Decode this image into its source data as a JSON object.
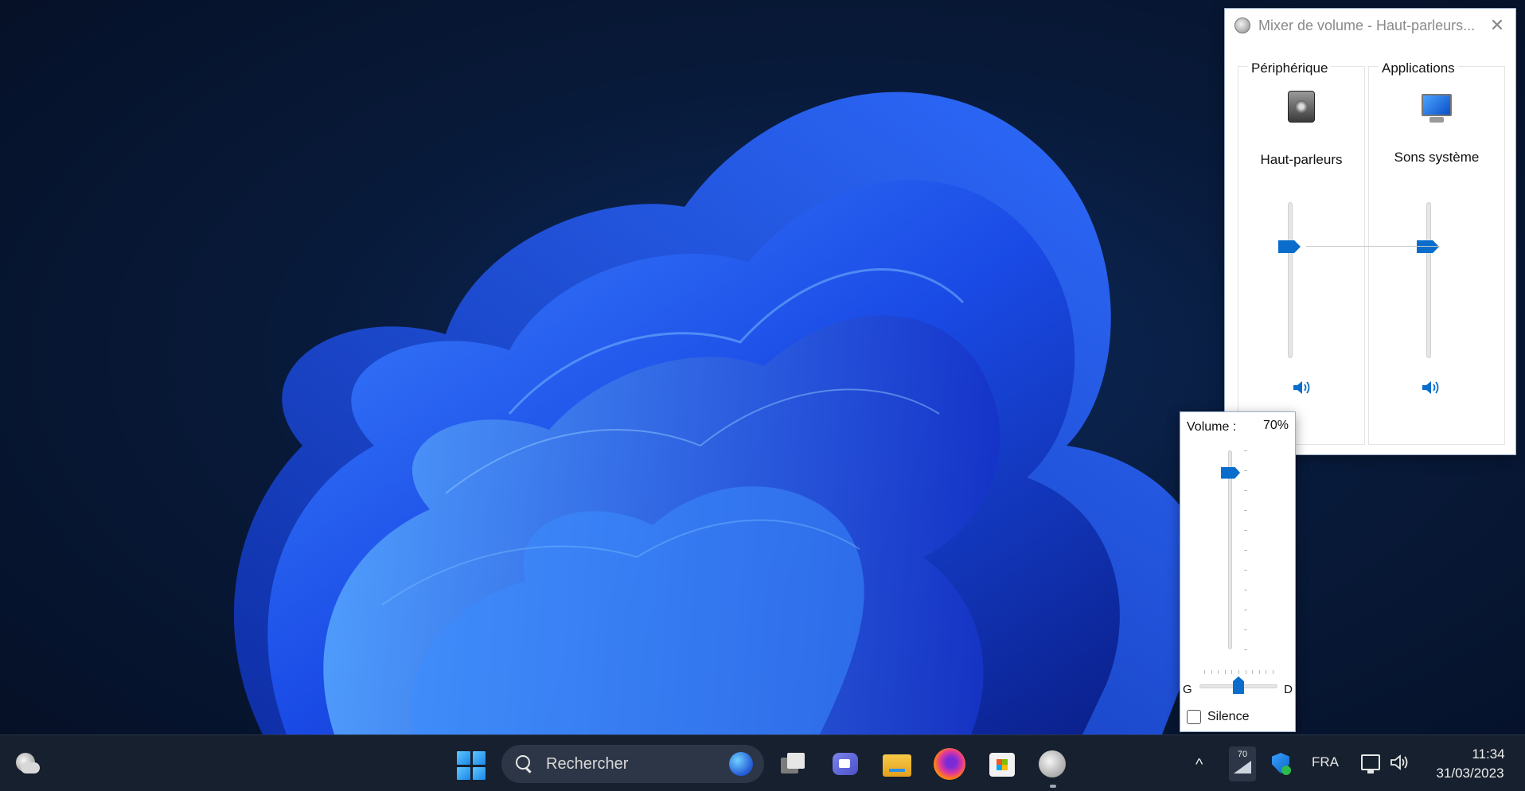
{
  "mixer": {
    "title": "Mixer de volume - Haut-parleurs...",
    "close_glyph": "✕",
    "device_group_label": "Périphérique",
    "apps_group_label": "Applications",
    "channels": [
      {
        "name": "Haut-parleurs",
        "icon": "speaker-device-icon",
        "volume_level": 0.7
      },
      {
        "name": "Sons système",
        "icon": "system-sounds-icon",
        "volume_level": 0.7
      }
    ]
  },
  "volume_popup": {
    "label": "Volume :",
    "value": "70%",
    "level": 0.7,
    "balance_left": "G",
    "balance_right": "D",
    "balance": 0.5,
    "mute_label": "Silence",
    "muted": false
  },
  "taskbar": {
    "search_placeholder": "Rechercher",
    "tray_chevron": "^",
    "network_usage": "70",
    "language": "FRA",
    "time": "11:34",
    "date": "31/03/2023",
    "apps": [
      "weather-icon",
      "start-button",
      "task-view-icon",
      "teams-chat-icon",
      "file-explorer-icon",
      "firefox-icon",
      "microsoft-store-icon",
      "volume-mixer-icon"
    ]
  },
  "colors": {
    "accent": "#0a6dcc",
    "taskbar_bg": "#16202e",
    "desktop_bg": "#081a3a",
    "bloom": "#1f54f0"
  }
}
